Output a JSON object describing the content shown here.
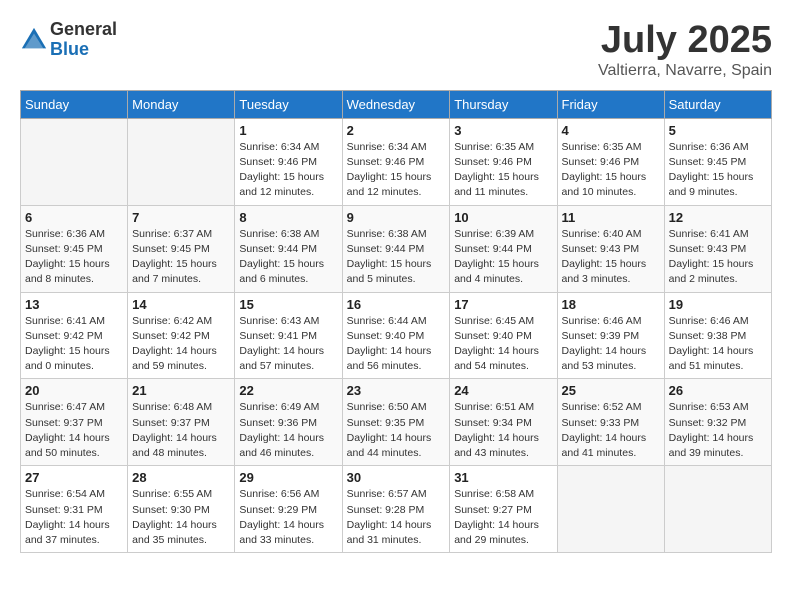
{
  "header": {
    "logo_general": "General",
    "logo_blue": "Blue",
    "title": "July 2025",
    "location": "Valtierra, Navarre, Spain"
  },
  "calendar": {
    "days_of_week": [
      "Sunday",
      "Monday",
      "Tuesday",
      "Wednesday",
      "Thursday",
      "Friday",
      "Saturday"
    ],
    "weeks": [
      [
        {
          "day": "",
          "empty": true
        },
        {
          "day": "",
          "empty": true
        },
        {
          "day": "1",
          "sunrise": "6:34 AM",
          "sunset": "9:46 PM",
          "daylight": "15 hours and 12 minutes."
        },
        {
          "day": "2",
          "sunrise": "6:34 AM",
          "sunset": "9:46 PM",
          "daylight": "15 hours and 12 minutes."
        },
        {
          "day": "3",
          "sunrise": "6:35 AM",
          "sunset": "9:46 PM",
          "daylight": "15 hours and 11 minutes."
        },
        {
          "day": "4",
          "sunrise": "6:35 AM",
          "sunset": "9:46 PM",
          "daylight": "15 hours and 10 minutes."
        },
        {
          "day": "5",
          "sunrise": "6:36 AM",
          "sunset": "9:45 PM",
          "daylight": "15 hours and 9 minutes."
        }
      ],
      [
        {
          "day": "6",
          "sunrise": "6:36 AM",
          "sunset": "9:45 PM",
          "daylight": "15 hours and 8 minutes."
        },
        {
          "day": "7",
          "sunrise": "6:37 AM",
          "sunset": "9:45 PM",
          "daylight": "15 hours and 7 minutes."
        },
        {
          "day": "8",
          "sunrise": "6:38 AM",
          "sunset": "9:44 PM",
          "daylight": "15 hours and 6 minutes."
        },
        {
          "day": "9",
          "sunrise": "6:38 AM",
          "sunset": "9:44 PM",
          "daylight": "15 hours and 5 minutes."
        },
        {
          "day": "10",
          "sunrise": "6:39 AM",
          "sunset": "9:44 PM",
          "daylight": "15 hours and 4 minutes."
        },
        {
          "day": "11",
          "sunrise": "6:40 AM",
          "sunset": "9:43 PM",
          "daylight": "15 hours and 3 minutes."
        },
        {
          "day": "12",
          "sunrise": "6:41 AM",
          "sunset": "9:43 PM",
          "daylight": "15 hours and 2 minutes."
        }
      ],
      [
        {
          "day": "13",
          "sunrise": "6:41 AM",
          "sunset": "9:42 PM",
          "daylight": "15 hours and 0 minutes."
        },
        {
          "day": "14",
          "sunrise": "6:42 AM",
          "sunset": "9:42 PM",
          "daylight": "14 hours and 59 minutes."
        },
        {
          "day": "15",
          "sunrise": "6:43 AM",
          "sunset": "9:41 PM",
          "daylight": "14 hours and 57 minutes."
        },
        {
          "day": "16",
          "sunrise": "6:44 AM",
          "sunset": "9:40 PM",
          "daylight": "14 hours and 56 minutes."
        },
        {
          "day": "17",
          "sunrise": "6:45 AM",
          "sunset": "9:40 PM",
          "daylight": "14 hours and 54 minutes."
        },
        {
          "day": "18",
          "sunrise": "6:46 AM",
          "sunset": "9:39 PM",
          "daylight": "14 hours and 53 minutes."
        },
        {
          "day": "19",
          "sunrise": "6:46 AM",
          "sunset": "9:38 PM",
          "daylight": "14 hours and 51 minutes."
        }
      ],
      [
        {
          "day": "20",
          "sunrise": "6:47 AM",
          "sunset": "9:37 PM",
          "daylight": "14 hours and 50 minutes."
        },
        {
          "day": "21",
          "sunrise": "6:48 AM",
          "sunset": "9:37 PM",
          "daylight": "14 hours and 48 minutes."
        },
        {
          "day": "22",
          "sunrise": "6:49 AM",
          "sunset": "9:36 PM",
          "daylight": "14 hours and 46 minutes."
        },
        {
          "day": "23",
          "sunrise": "6:50 AM",
          "sunset": "9:35 PM",
          "daylight": "14 hours and 44 minutes."
        },
        {
          "day": "24",
          "sunrise": "6:51 AM",
          "sunset": "9:34 PM",
          "daylight": "14 hours and 43 minutes."
        },
        {
          "day": "25",
          "sunrise": "6:52 AM",
          "sunset": "9:33 PM",
          "daylight": "14 hours and 41 minutes."
        },
        {
          "day": "26",
          "sunrise": "6:53 AM",
          "sunset": "9:32 PM",
          "daylight": "14 hours and 39 minutes."
        }
      ],
      [
        {
          "day": "27",
          "sunrise": "6:54 AM",
          "sunset": "9:31 PM",
          "daylight": "14 hours and 37 minutes."
        },
        {
          "day": "28",
          "sunrise": "6:55 AM",
          "sunset": "9:30 PM",
          "daylight": "14 hours and 35 minutes."
        },
        {
          "day": "29",
          "sunrise": "6:56 AM",
          "sunset": "9:29 PM",
          "daylight": "14 hours and 33 minutes."
        },
        {
          "day": "30",
          "sunrise": "6:57 AM",
          "sunset": "9:28 PM",
          "daylight": "14 hours and 31 minutes."
        },
        {
          "day": "31",
          "sunrise": "6:58 AM",
          "sunset": "9:27 PM",
          "daylight": "14 hours and 29 minutes."
        },
        {
          "day": "",
          "empty": true
        },
        {
          "day": "",
          "empty": true
        }
      ]
    ]
  }
}
